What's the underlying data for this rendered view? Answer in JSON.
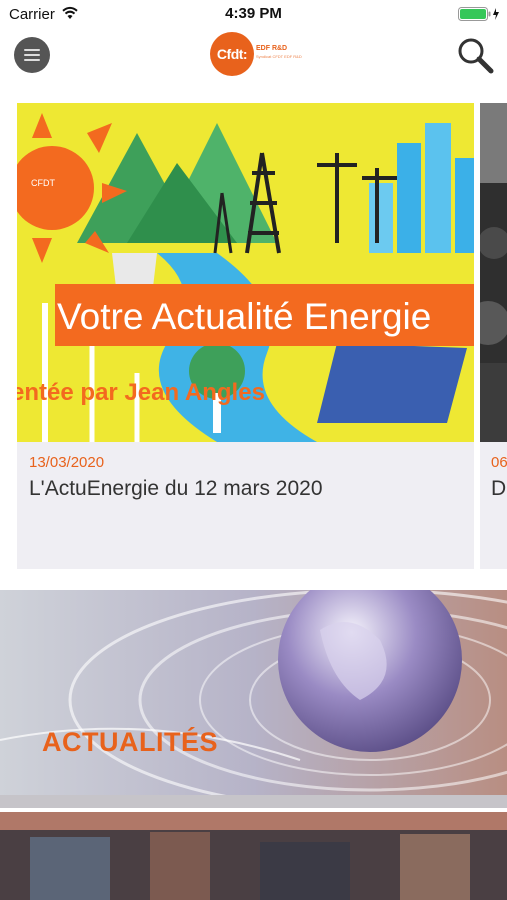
{
  "status_bar": {
    "carrier": "Carrier",
    "time": "4:39 PM"
  },
  "header": {
    "logo_text": "Cfdt:",
    "logo_subtitle": "EDF R&D",
    "logo_tagline": "Syndicat CFDT EDF R&D"
  },
  "carousel": {
    "cards": [
      {
        "date": "13/03/2020",
        "title": "L'ActuEnergie du 12 mars 2020",
        "image_heading": "Votre Actualité Energie",
        "image_caption": "Présentée par Jean Angles",
        "image_badge": "CFDT"
      },
      {
        "date": "06",
        "title": "D"
      }
    ]
  },
  "banners": {
    "actualites": "ACTUALITÉS"
  },
  "colors": {
    "accent": "#e8621c",
    "card_bg": "#efeef3",
    "illustration_yellow": "#eee833"
  }
}
